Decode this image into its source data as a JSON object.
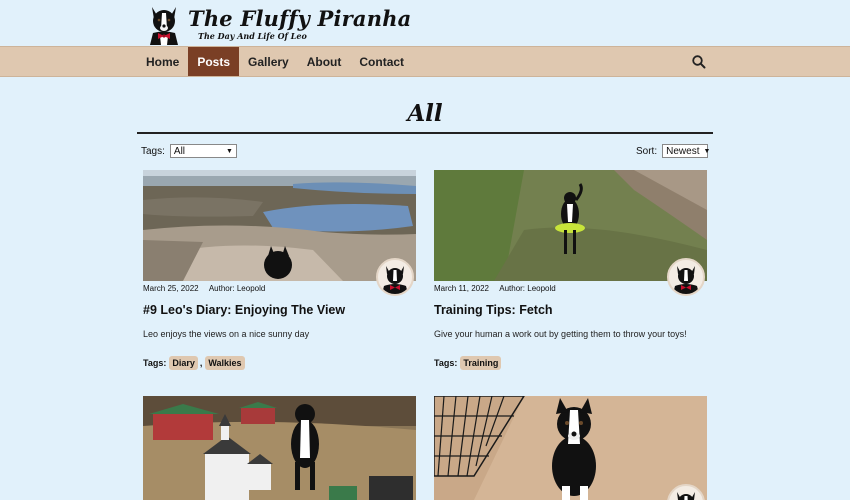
{
  "site": {
    "title": "The Fluffy Piranha",
    "tagline": "The Day And Life Of Leo"
  },
  "nav": {
    "items": [
      "Home",
      "Posts",
      "Gallery",
      "About",
      "Contact"
    ],
    "active": "Posts"
  },
  "page": {
    "heading": "All"
  },
  "filters": {
    "tags_label": "Tags:",
    "tags_value": "All",
    "sort_label": "Sort:",
    "sort_value": "Newest"
  },
  "posts": [
    {
      "date": "March 25, 2022",
      "author": "Author: Leopold",
      "title": "#9 Leo's Diary: Enjoying The View",
      "excerpt": "Leo enjoys the views on a nice sunny day",
      "tags_label": "Tags:",
      "tags": [
        "Diary",
        "Walkies"
      ]
    },
    {
      "date": "March 11, 2022",
      "author": "Author: Leopold",
      "title": "Training Tips: Fetch",
      "excerpt": "Give your human a work out by getting them to throw your toys!",
      "tags_label": "Tags:",
      "tags": [
        "Training"
      ]
    }
  ],
  "colors": {
    "background": "#e1f1fb",
    "nav_bar": "#dfc8b0",
    "nav_active": "#7a3f25",
    "tag_chip": "#dfc8b0"
  }
}
